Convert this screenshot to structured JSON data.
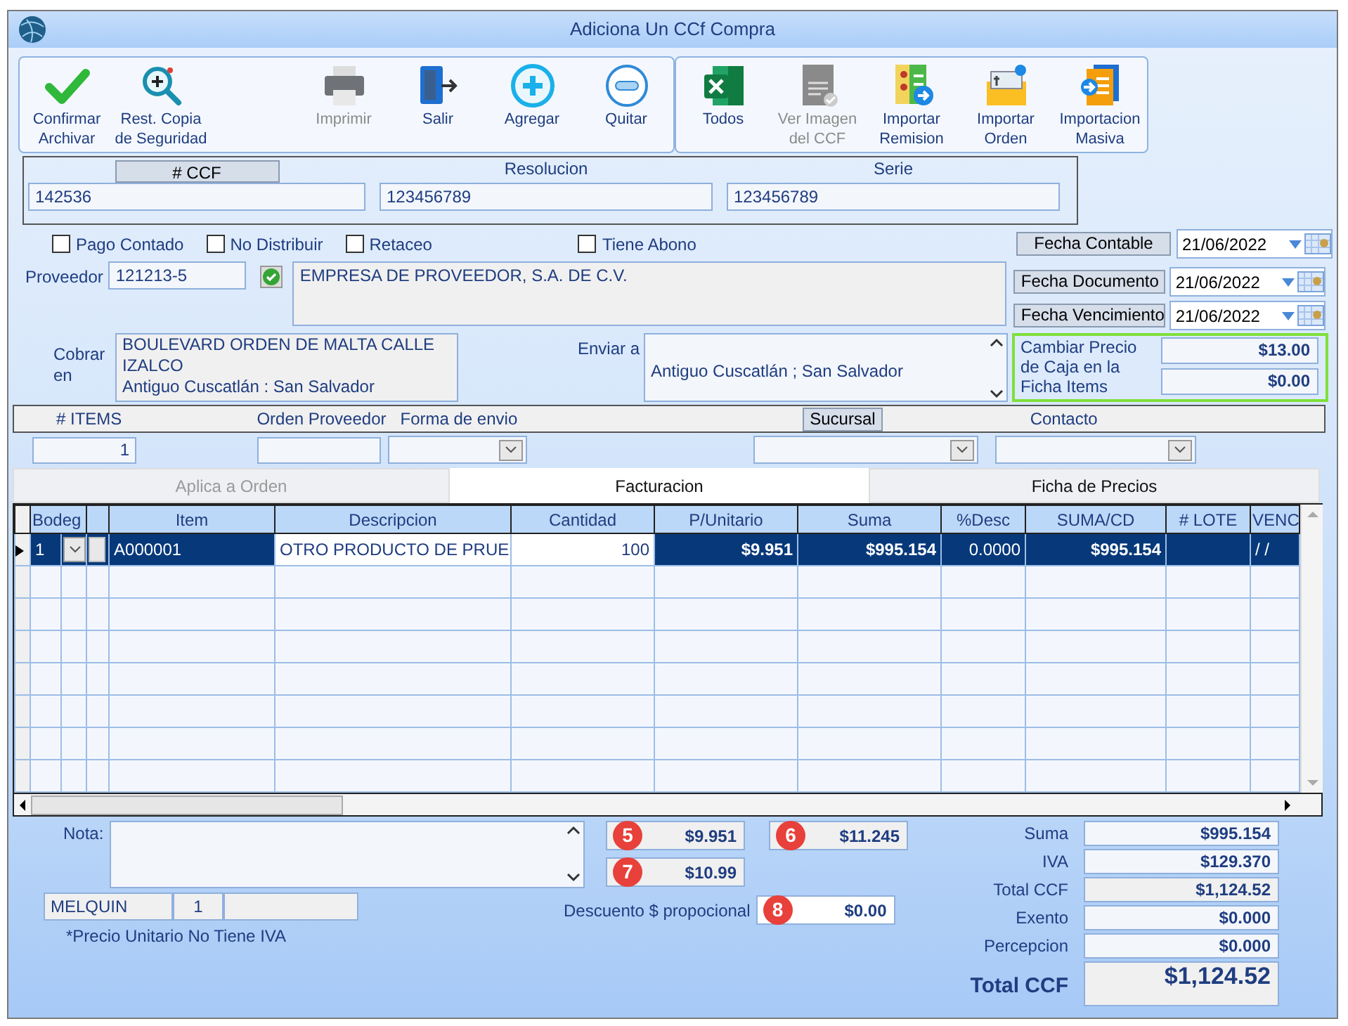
{
  "window": {
    "title": "Adiciona Un CCf Compra"
  },
  "toolbar": [
    {
      "buttons": [
        {
          "label": "Confirmar\nArchivar",
          "disabled": false
        },
        {
          "label": "Rest. Copia\nde Seguridad",
          "disabled": false
        },
        {
          "label": "Imprimir",
          "disabled": true
        },
        {
          "label": "Salir",
          "disabled": false
        },
        {
          "label": "Agregar",
          "disabled": false
        },
        {
          "label": "Quitar",
          "disabled": false
        }
      ]
    },
    {
      "buttons": [
        {
          "label": "Todos",
          "disabled": false
        },
        {
          "label": "Ver Imagen\ndel CCF",
          "disabled": true
        },
        {
          "label": "Importar\nRemision",
          "disabled": false
        },
        {
          "label": "Importar\nOrden",
          "disabled": false
        },
        {
          "label": "Importacion\nMasiva",
          "disabled": false
        }
      ]
    }
  ],
  "document": [
    {
      "label": "# CCF",
      "value": "142536",
      "kind": "button"
    },
    {
      "label": "Resolucion",
      "value": "123456789",
      "kind": "plain"
    },
    {
      "label": "Serie",
      "value": "123456789",
      "kind": "plain"
    }
  ],
  "options": [
    {
      "label": "Pago Contado",
      "checked": false
    },
    {
      "label": "No Distribuir",
      "checked": false
    },
    {
      "label": "Retaceo",
      "checked": false
    },
    {
      "label": "Tiene Abono",
      "checked": false
    }
  ],
  "dates": [
    {
      "label": "Fecha Contable",
      "value": "21/06/2022"
    },
    {
      "label": "Fecha Documento",
      "value": "21/06/2022"
    },
    {
      "label": "Fecha Vencimiento",
      "value": "21/06/2022"
    }
  ],
  "proveedor": {
    "label": "Proveedor",
    "code": "121213-5",
    "name": "EMPRESA DE PROVEEDOR, S.A. DE C.V."
  },
  "cobrar": {
    "label": "Cobrar\nen",
    "address": "BOULEVARD ORDEN DE MALTA CALLE\nIZALCO\nAntiguo Cuscatlán : San Salvador"
  },
  "enviar": {
    "label": "Enviar a",
    "address": "Antiguo Cuscatlán ; San Salvador"
  },
  "precio_caja": {
    "label": "Cambiar Precio\nde Caja en la\nFicha Items",
    "values": [
      "$13.00",
      "$0.00"
    ]
  },
  "details": {
    "items_label": "# ITEMS",
    "items_value": "1",
    "orden_label": "Orden Proveedor",
    "forma_label": "Forma de envio",
    "sucursal_label": "Sucursal",
    "contacto_label": "Contacto"
  },
  "tabs": [
    {
      "label": "Aplica a Orden",
      "selected": false,
      "disabled": true
    },
    {
      "label": "Facturacion",
      "selected": true,
      "disabled": false
    },
    {
      "label": "Ficha de Precios",
      "selected": false,
      "disabled": false
    }
  ],
  "grid": {
    "columns": {
      "bodega": "Bodeg",
      "item": "Item",
      "descripcion": "Descripcion",
      "cantidad": "Cantidad",
      "p_unitario": "P/Unitario",
      "suma": "Suma",
      "desc": "%Desc",
      "suma_cd": "SUMA/CD",
      "lote": "# LOTE",
      "vencimiento": "VENC"
    },
    "rows": [
      {
        "selected": true,
        "bodega": "1",
        "item": "A000001",
        "descripcion": "OTRO PRODUCTO DE PRUE",
        "cantidad": "100",
        "p_unitario": "$9.951",
        "suma": "$995.154",
        "desc": "0.0000",
        "suma_cd": "$995.154",
        "vencimiento": "/ /"
      }
    ]
  },
  "nota": {
    "label": "Nota:"
  },
  "user": {
    "name": "MELQUIN",
    "number": "1"
  },
  "footnote": "*Precio Unitario No Tiene IVA",
  "markers": [
    {
      "number": "5",
      "value": "$9.951"
    },
    {
      "number": "6",
      "value": "$11.245"
    },
    {
      "number": "7",
      "value": "$10.99"
    },
    {
      "number": "8",
      "value": "$0.00",
      "label": "Descuento $ propocional"
    }
  ],
  "totals": [
    {
      "label": "Suma",
      "value": "$995.154",
      "kind": "normal"
    },
    {
      "label": "IVA",
      "value": "$129.370",
      "kind": "normal"
    },
    {
      "label": "Total CCF",
      "value": "$1,124.52",
      "kind": "shaded"
    },
    {
      "label": "Exento",
      "value": "$0.000",
      "kind": "normal"
    },
    {
      "label": "Percepcion",
      "value": "$0.000",
      "kind": "normal"
    },
    {
      "label": "Total CCF",
      "value": "$1,124.52",
      "kind": "grand"
    }
  ]
}
